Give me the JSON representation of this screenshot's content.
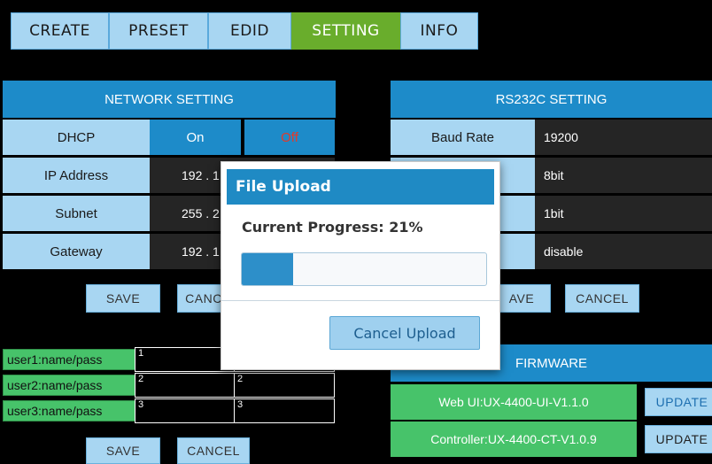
{
  "tabs": [
    "CREATE",
    "PRESET",
    "EDID",
    "SETTING",
    "INFO"
  ],
  "network": {
    "title": "NETWORK SETTING",
    "dhcp_label": "DHCP",
    "dhcp_on": "On",
    "dhcp_off": "Off",
    "rows": [
      {
        "label": "IP Address",
        "value": "192 . 1"
      },
      {
        "label": "Subnet",
        "value": "255 . 2"
      },
      {
        "label": "Gateway",
        "value": "192 . 1"
      }
    ],
    "save": "SAVE",
    "cancel": "CANC"
  },
  "rs232": {
    "title": "RS232C SETTING",
    "rows": [
      {
        "label": "Baud Rate",
        "value": "19200"
      },
      {
        "label": "",
        "value": "8bit"
      },
      {
        "label": "",
        "value": "1bit"
      },
      {
        "label": "",
        "value": "disable"
      }
    ],
    "save": "AVE",
    "cancel": "CANCEL"
  },
  "users": {
    "rows": [
      {
        "label": "user1:name/pass",
        "name": "1",
        "pass": ""
      },
      {
        "label": "user2:name/pass",
        "name": "2",
        "pass": "2"
      },
      {
        "label": "user3:name/pass",
        "name": "3",
        "pass": "3"
      }
    ],
    "save": "SAVE",
    "cancel": "CANCEL"
  },
  "firmware": {
    "title": "FIRMWARE",
    "rows": [
      {
        "label": "Web UI:UX-4400-UI-V1.1.0",
        "button": "UPDATE"
      },
      {
        "label": "Controller:UX-4400-CT-V1.0.9",
        "button": "UPDATE"
      }
    ]
  },
  "dialog": {
    "title": "File Upload",
    "progress_text": "Current Progress: 21%",
    "progress": 0.21,
    "cancel": "Cancel Upload"
  }
}
